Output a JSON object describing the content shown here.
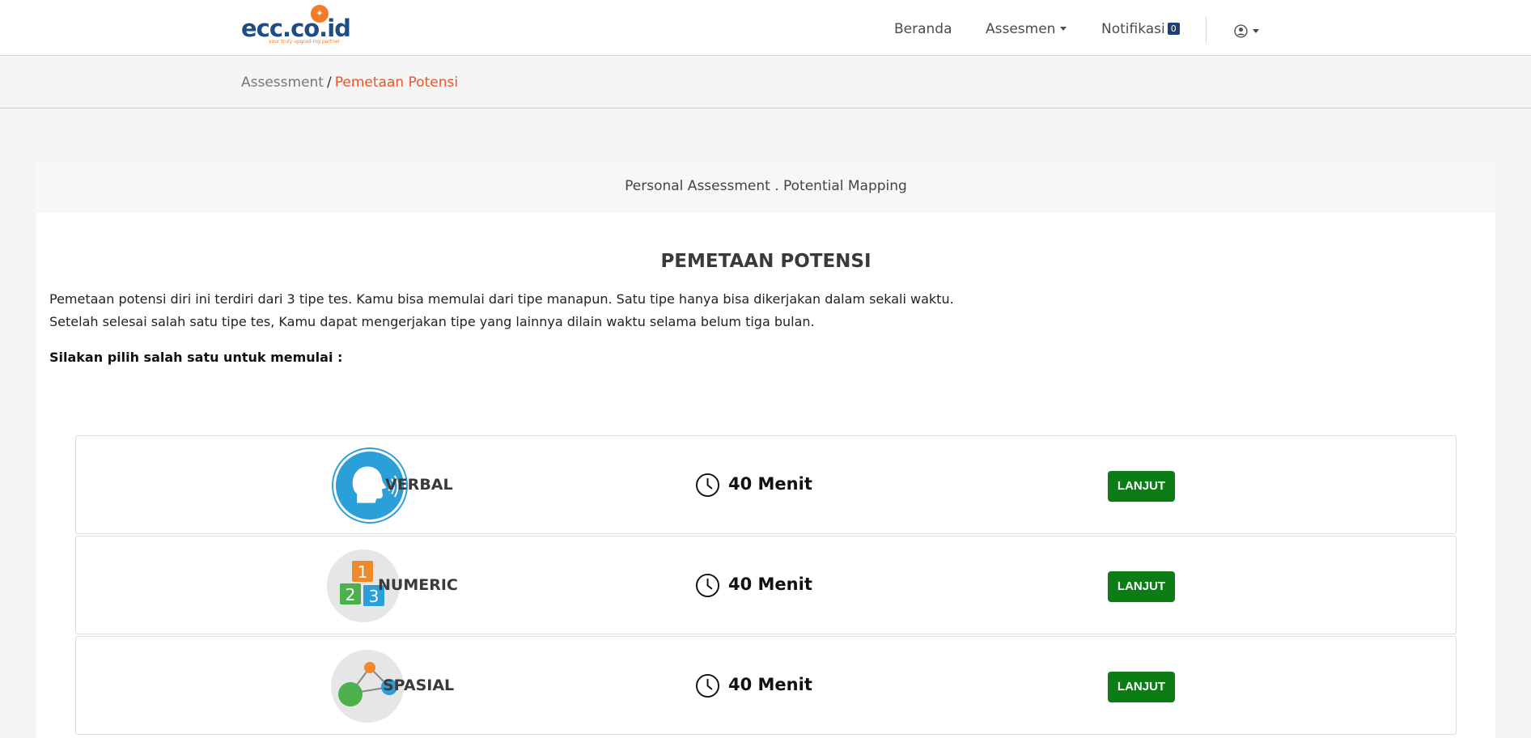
{
  "navbar": {
    "logo_text": "ecc.co.id",
    "logo_tagline": "your truly upgrad-ing partner",
    "links": {
      "beranda": "Beranda",
      "assesmen": "Assesmen",
      "notifikasi": "Notifikasi"
    },
    "notification_count": "0",
    "icons": {
      "user": "user-circle-icon",
      "caret": "caret-down-icon"
    }
  },
  "breadcrumb": {
    "parent": "Assessment",
    "separator": "/",
    "current": "Pemetaan Potensi"
  },
  "card": {
    "header": "Personal Assessment . Potential Mapping",
    "title": "PEMETAAN POTENSI",
    "description_line1": "Pemetaan potensi diri ini terdiri dari 3 tipe tes. Kamu bisa memulai dari tipe manapun. Satu tipe hanya bisa dikerjakan dalam sekali waktu.",
    "description_line2": "Setelah selesai salah satu tipe tes, Kamu dapat mengerjakan tipe yang lainnya dilain waktu selama belum tiga bulan.",
    "instruction": "Silakan pilih salah satu untuk memulai :"
  },
  "tests": [
    {
      "name": "VERBAL",
      "duration": "40 Menit",
      "button": "LANJUT",
      "icon": "speaking-head-icon"
    },
    {
      "name": "NUMERIC",
      "duration": "40 Menit",
      "button": "LANJUT",
      "icon": "number-blocks-icon"
    },
    {
      "name": "SPASIAL",
      "duration": "40 Menit",
      "button": "LANJUT",
      "icon": "connected-nodes-icon"
    }
  ],
  "colors": {
    "accent_orange": "#e8562a",
    "brand_blue": "#1d4c86",
    "button_green": "#0b7d14",
    "badge_navy": "#1c3f74"
  }
}
